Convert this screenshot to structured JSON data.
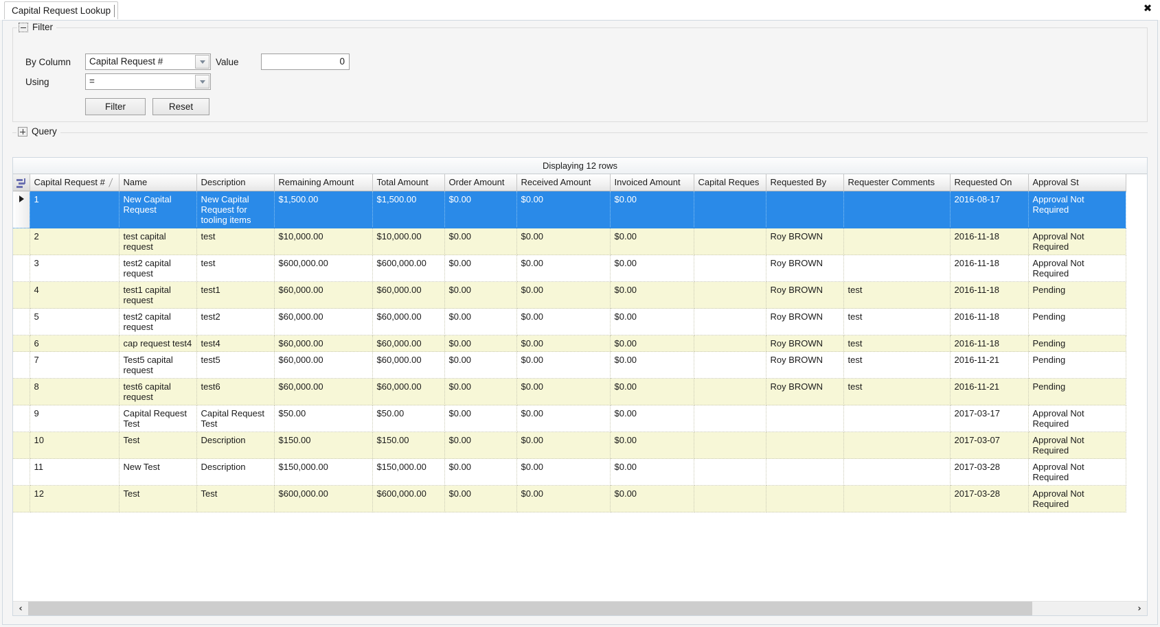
{
  "window": {
    "tab_label": "Capital Request Lookup",
    "close_label": "✖"
  },
  "filter_panel": {
    "caption": "Filter",
    "by_column_label": "By Column",
    "by_column_value": "Capital Request #",
    "value_label": "Value",
    "value_field": "0",
    "using_label": "Using",
    "using_value": "=",
    "filter_button": "Filter",
    "reset_button": "Reset"
  },
  "query_panel": {
    "caption": "Query"
  },
  "grid": {
    "status": "Displaying 12 rows",
    "sort_glyph": "╱",
    "columns": [
      "Capital Request #",
      "Name",
      "Description",
      "Remaining Amount",
      "Total Amount",
      "Order Amount",
      "Received Amount",
      "Invoiced Amount",
      "Capital Reques",
      "Requested By",
      "Requester Comments",
      "Requested On",
      "Approval St"
    ],
    "rows": [
      {
        "state": "sel",
        "cells": [
          "1",
          "New Capital Request",
          "New Capital Request for tooling items",
          "$1,500.00",
          "$1,500.00",
          "$0.00",
          "$0.00",
          "$0.00",
          "",
          "",
          "",
          "2016-08-17",
          "Approval Not Required"
        ]
      },
      {
        "state": "alt",
        "cells": [
          "2",
          "test capital request",
          "test",
          "$10,000.00",
          "$10,000.00",
          "$0.00",
          "$0.00",
          "$0.00",
          "",
          "Roy BROWN",
          "",
          "2016-11-18",
          "Approval Not Required"
        ]
      },
      {
        "state": "norm",
        "cells": [
          "3",
          "test2 capital request",
          "test",
          "$600,000.00",
          "$600,000.00",
          "$0.00",
          "$0.00",
          "$0.00",
          "",
          "Roy BROWN",
          "",
          "2016-11-18",
          "Approval Not Required"
        ]
      },
      {
        "state": "alt",
        "cells": [
          "4",
          "test1 capital request",
          "test1",
          "$60,000.00",
          "$60,000.00",
          "$0.00",
          "$0.00",
          "$0.00",
          "",
          "Roy BROWN",
          "test",
          "2016-11-18",
          "Pending"
        ]
      },
      {
        "state": "norm",
        "cells": [
          "5",
          "test2 capital request",
          "test2",
          "$60,000.00",
          "$60,000.00",
          "$0.00",
          "$0.00",
          "$0.00",
          "",
          "Roy BROWN",
          "test",
          "2016-11-18",
          "Pending"
        ]
      },
      {
        "state": "alt",
        "cells": [
          "6",
          "cap request test4",
          "test4",
          "$60,000.00",
          "$60,000.00",
          "$0.00",
          "$0.00",
          "$0.00",
          "",
          "Roy BROWN",
          "test",
          "2016-11-18",
          "Pending"
        ]
      },
      {
        "state": "norm",
        "cells": [
          "7",
          "Test5 capital request",
          "test5",
          "$60,000.00",
          "$60,000.00",
          "$0.00",
          "$0.00",
          "$0.00",
          "",
          "Roy BROWN",
          "test",
          "2016-11-21",
          "Pending"
        ]
      },
      {
        "state": "alt",
        "cells": [
          "8",
          "test6 capital request",
          "test6",
          "$60,000.00",
          "$60,000.00",
          "$0.00",
          "$0.00",
          "$0.00",
          "",
          "Roy BROWN",
          "test",
          "2016-11-21",
          "Pending"
        ]
      },
      {
        "state": "norm",
        "cells": [
          "9",
          "Capital Request Test",
          "Capital Request Test",
          "$50.00",
          "$50.00",
          "$0.00",
          "$0.00",
          "$0.00",
          "",
          "",
          "",
          "2017-03-17",
          "Approval Not Required"
        ]
      },
      {
        "state": "alt",
        "cells": [
          "10",
          "Test",
          "Description",
          "$150.00",
          "$150.00",
          "$0.00",
          "$0.00",
          "$0.00",
          "",
          "",
          "",
          "2017-03-07",
          "Approval Not Required"
        ]
      },
      {
        "state": "norm",
        "cells": [
          "11",
          "New Test",
          "Description",
          "$150,000.00",
          "$150,000.00",
          "$0.00",
          "$0.00",
          "$0.00",
          "",
          "",
          "",
          "2017-03-28",
          "Approval Not Required"
        ]
      },
      {
        "state": "alt",
        "cells": [
          "12",
          "Test",
          "Test",
          "$600,000.00",
          "$600,000.00",
          "$0.00",
          "$0.00",
          "$0.00",
          "",
          "",
          "",
          "2017-03-28",
          "Approval Not Required"
        ]
      }
    ]
  },
  "scrollbar": {
    "left_arrow": "‹",
    "right_arrow": "›"
  },
  "colors": {
    "selection_blue": "#2a8ae8",
    "alt_row_yellow": "#f7f7d7",
    "panel_grey": "#f5f5f5"
  }
}
